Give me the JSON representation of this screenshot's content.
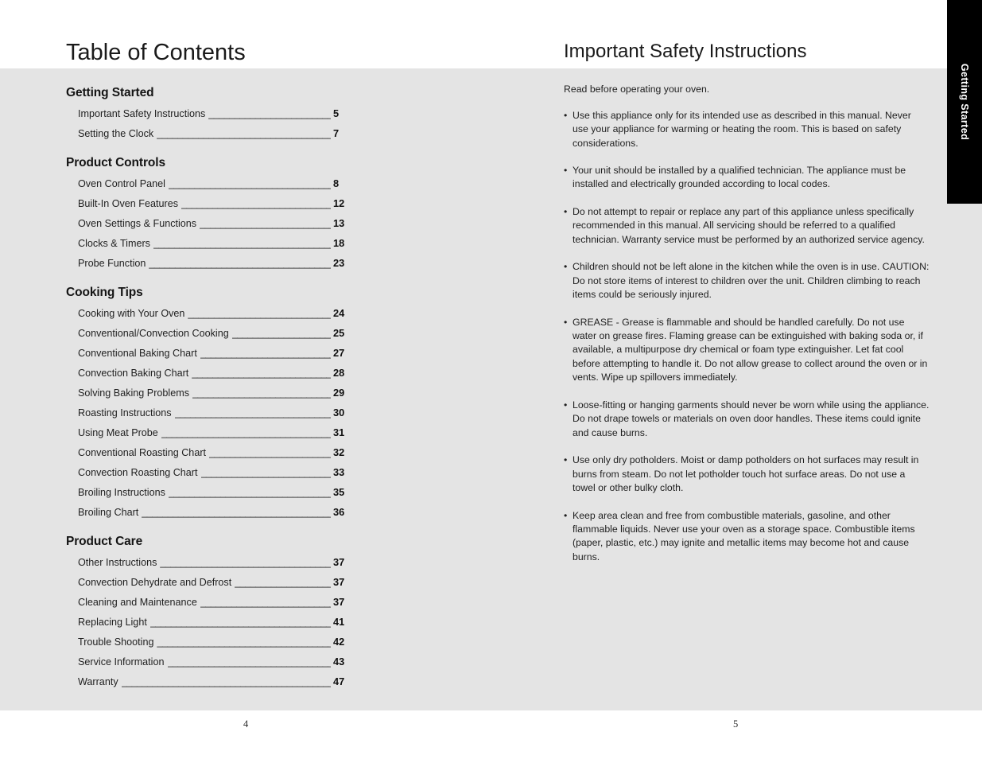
{
  "side_tab": {
    "label": "Getting Started"
  },
  "left_page": {
    "title": "Table of Contents",
    "folio": "4",
    "sections": [
      {
        "heading": "Getting Started",
        "entries": [
          {
            "title": "Important Safety Instructions",
            "page": "5"
          },
          {
            "title": "Setting the Clock",
            "page": "7"
          }
        ]
      },
      {
        "heading": "Product Controls",
        "entries": [
          {
            "title": "Oven Control Panel",
            "page": "8"
          },
          {
            "title": "Built-In Oven Features",
            "page": "12"
          },
          {
            "title": "Oven Settings & Functions",
            "page": "13"
          },
          {
            "title": "Clocks & Timers",
            "page": "18"
          },
          {
            "title": "Probe Function",
            "page": "23"
          }
        ]
      },
      {
        "heading": "Cooking Tips",
        "entries": [
          {
            "title": "Cooking with Your Oven",
            "page": "24"
          },
          {
            "title": "Conventional/Convection Cooking",
            "page": "25"
          },
          {
            "title": "Conventional Baking Chart",
            "page": "27"
          },
          {
            "title": "Convection Baking Chart",
            "page": "28"
          },
          {
            "title": "Solving Baking Problems",
            "page": "29"
          },
          {
            "title": "Roasting Instructions",
            "page": "30"
          },
          {
            "title": "Using Meat Probe",
            "page": "31"
          },
          {
            "title": "Conventional Roasting Chart",
            "page": "32"
          },
          {
            "title": "Convection Roasting Chart",
            "page": "33"
          },
          {
            "title": "Broiling Instructions",
            "page": "35"
          },
          {
            "title": "Broiling Chart",
            "page": "36"
          }
        ]
      },
      {
        "heading": "Product Care",
        "entries": [
          {
            "title": "Other Instructions",
            "page": "37"
          },
          {
            "title": "Convection Dehydrate and Defrost",
            "page": "37"
          },
          {
            "title": "Cleaning and Maintenance",
            "page": "37"
          },
          {
            "title": "Replacing Light",
            "page": "41"
          },
          {
            "title": "Trouble Shooting",
            "page": "42"
          },
          {
            "title": "Service Information",
            "page": "43"
          },
          {
            "title": "Warranty",
            "page": "47"
          }
        ]
      }
    ]
  },
  "right_page": {
    "title": "Important Safety Instructions",
    "folio": "5",
    "intro": "Read before operating your oven.",
    "bullet_marker": "•",
    "bullets": [
      "Use this appliance only for its intended use as described in this manual. Never use your appliance for warming or heating the room. This is based on safety considerations.",
      "Your unit should be installed by a qualified technician. The appliance must be installed and electrically grounded according to local codes.",
      "Do not attempt to repair or replace any part of this appliance unless specifically recommended in this manual. All servicing should be referred to a qualified technician. Warranty service must be performed by an authorized service agency.",
      "Children should not be left alone in the kitchen while the oven is in use. CAUTION: Do not store items of interest to children over the unit. Children climbing to reach items could be seriously injured.",
      "GREASE - Grease is flammable and should be handled carefully.  Do not use water on grease fires. Flaming grease can be extinguished with baking soda or, if available, a multipurpose dry chemical or foam type extinguisher. Let fat cool before attempting to handle it. Do not allow grease to collect around the oven or in vents. Wipe up spillovers immediately.",
      "Loose-fitting or hanging garments should never be worn while using the appliance. Do not drape towels or materials on oven door handles. These items could ignite and cause burns.",
      "Use only dry potholders. Moist or damp potholders on hot surfaces may result in burns from steam. Do not let potholder touch hot surface areas. Do not use a towel or other bulky cloth.",
      "Keep area clean and free from combustible materials, gasoline, and other flammable liquids. Never use your oven as a storage space. Combustible items (paper, plastic, etc.) may ignite and metallic items may become hot and cause burns."
    ]
  },
  "colors": {
    "content_background": "#e4e4e4",
    "page_background": "#ffffff",
    "tab_background": "#000000",
    "tab_text": "#ffffff",
    "body_text": "#1f1f1f"
  }
}
